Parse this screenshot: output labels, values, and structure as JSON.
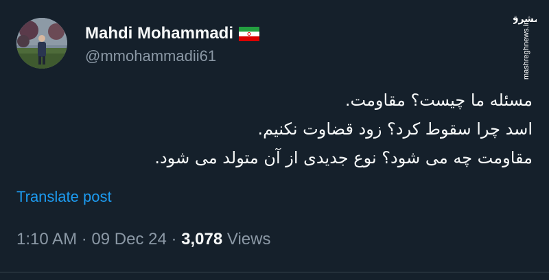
{
  "author": {
    "display_name": "Mahdi Mohammadi",
    "handle": "@mmohammadii61",
    "flag_icon": "iran-flag-icon",
    "avatar_icon": "profile-photo"
  },
  "watermark": {
    "logo_text": "مشرق",
    "site": "mashreghnews.ir"
  },
  "tweet": {
    "lines": [
      "مسئله ما چیست؟ مقاومت.",
      "اسد چرا سقوط کرد؟ زود قضاوت نکنیم.",
      "مقاومت چه می شود؟ نوع جدیدی از آن متولد می شود."
    ],
    "translate_label": "Translate post"
  },
  "meta": {
    "time": "1:10 AM",
    "separator": "·",
    "date": "09 Dec 24",
    "views_count": "3,078",
    "views_label": "Views"
  },
  "colors": {
    "background": "#15202b",
    "text": "#f7f9f9",
    "secondary": "#8b98a5",
    "link": "#1d9bf0",
    "divider": "#38444d"
  }
}
